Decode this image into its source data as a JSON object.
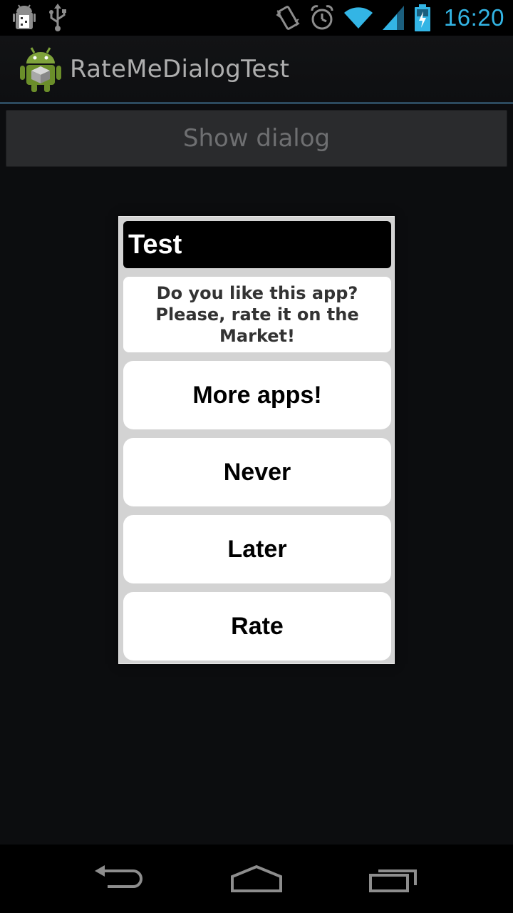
{
  "status_bar": {
    "time": "16:20",
    "icons": [
      "android-debug-icon",
      "usb-icon",
      "vibrate-icon",
      "alarm-icon",
      "wifi-icon",
      "signal-icon",
      "battery-charging-icon"
    ],
    "accent_color": "#33b5e5"
  },
  "action_bar": {
    "title": "RateMeDialogTest",
    "logo_icon": "android-robot-icon"
  },
  "main": {
    "show_dialog_label": "Show dialog"
  },
  "dialog": {
    "title": "Test",
    "message_line1": "Do you like this app?",
    "message_line2": "Please, rate it on the Market!",
    "buttons": {
      "more_apps": "More apps!",
      "never": "Never",
      "later": "Later",
      "rate": "Rate"
    }
  },
  "nav_bar": {
    "icons": [
      "back-icon",
      "home-icon",
      "recent-apps-icon"
    ]
  }
}
